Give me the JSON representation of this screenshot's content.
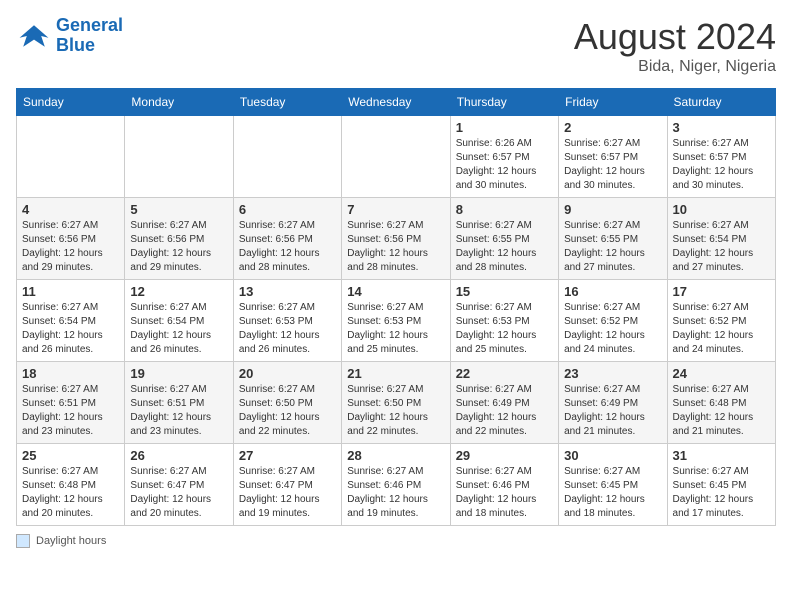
{
  "logo": {
    "line1": "General",
    "line2": "Blue"
  },
  "title": "August 2024",
  "subtitle": "Bida, Niger, Nigeria",
  "days_of_week": [
    "Sunday",
    "Monday",
    "Tuesday",
    "Wednesday",
    "Thursday",
    "Friday",
    "Saturday"
  ],
  "weeks": [
    [
      {
        "day": "",
        "info": ""
      },
      {
        "day": "",
        "info": ""
      },
      {
        "day": "",
        "info": ""
      },
      {
        "day": "",
        "info": ""
      },
      {
        "day": "1",
        "info": "Sunrise: 6:26 AM\nSunset: 6:57 PM\nDaylight: 12 hours and 30 minutes."
      },
      {
        "day": "2",
        "info": "Sunrise: 6:27 AM\nSunset: 6:57 PM\nDaylight: 12 hours and 30 minutes."
      },
      {
        "day": "3",
        "info": "Sunrise: 6:27 AM\nSunset: 6:57 PM\nDaylight: 12 hours and 30 minutes."
      }
    ],
    [
      {
        "day": "4",
        "info": "Sunrise: 6:27 AM\nSunset: 6:56 PM\nDaylight: 12 hours and 29 minutes."
      },
      {
        "day": "5",
        "info": "Sunrise: 6:27 AM\nSunset: 6:56 PM\nDaylight: 12 hours and 29 minutes."
      },
      {
        "day": "6",
        "info": "Sunrise: 6:27 AM\nSunset: 6:56 PM\nDaylight: 12 hours and 28 minutes."
      },
      {
        "day": "7",
        "info": "Sunrise: 6:27 AM\nSunset: 6:56 PM\nDaylight: 12 hours and 28 minutes."
      },
      {
        "day": "8",
        "info": "Sunrise: 6:27 AM\nSunset: 6:55 PM\nDaylight: 12 hours and 28 minutes."
      },
      {
        "day": "9",
        "info": "Sunrise: 6:27 AM\nSunset: 6:55 PM\nDaylight: 12 hours and 27 minutes."
      },
      {
        "day": "10",
        "info": "Sunrise: 6:27 AM\nSunset: 6:54 PM\nDaylight: 12 hours and 27 minutes."
      }
    ],
    [
      {
        "day": "11",
        "info": "Sunrise: 6:27 AM\nSunset: 6:54 PM\nDaylight: 12 hours and 26 minutes."
      },
      {
        "day": "12",
        "info": "Sunrise: 6:27 AM\nSunset: 6:54 PM\nDaylight: 12 hours and 26 minutes."
      },
      {
        "day": "13",
        "info": "Sunrise: 6:27 AM\nSunset: 6:53 PM\nDaylight: 12 hours and 26 minutes."
      },
      {
        "day": "14",
        "info": "Sunrise: 6:27 AM\nSunset: 6:53 PM\nDaylight: 12 hours and 25 minutes."
      },
      {
        "day": "15",
        "info": "Sunrise: 6:27 AM\nSunset: 6:53 PM\nDaylight: 12 hours and 25 minutes."
      },
      {
        "day": "16",
        "info": "Sunrise: 6:27 AM\nSunset: 6:52 PM\nDaylight: 12 hours and 24 minutes."
      },
      {
        "day": "17",
        "info": "Sunrise: 6:27 AM\nSunset: 6:52 PM\nDaylight: 12 hours and 24 minutes."
      }
    ],
    [
      {
        "day": "18",
        "info": "Sunrise: 6:27 AM\nSunset: 6:51 PM\nDaylight: 12 hours and 23 minutes."
      },
      {
        "day": "19",
        "info": "Sunrise: 6:27 AM\nSunset: 6:51 PM\nDaylight: 12 hours and 23 minutes."
      },
      {
        "day": "20",
        "info": "Sunrise: 6:27 AM\nSunset: 6:50 PM\nDaylight: 12 hours and 22 minutes."
      },
      {
        "day": "21",
        "info": "Sunrise: 6:27 AM\nSunset: 6:50 PM\nDaylight: 12 hours and 22 minutes."
      },
      {
        "day": "22",
        "info": "Sunrise: 6:27 AM\nSunset: 6:49 PM\nDaylight: 12 hours and 22 minutes."
      },
      {
        "day": "23",
        "info": "Sunrise: 6:27 AM\nSunset: 6:49 PM\nDaylight: 12 hours and 21 minutes."
      },
      {
        "day": "24",
        "info": "Sunrise: 6:27 AM\nSunset: 6:48 PM\nDaylight: 12 hours and 21 minutes."
      }
    ],
    [
      {
        "day": "25",
        "info": "Sunrise: 6:27 AM\nSunset: 6:48 PM\nDaylight: 12 hours and 20 minutes."
      },
      {
        "day": "26",
        "info": "Sunrise: 6:27 AM\nSunset: 6:47 PM\nDaylight: 12 hours and 20 minutes."
      },
      {
        "day": "27",
        "info": "Sunrise: 6:27 AM\nSunset: 6:47 PM\nDaylight: 12 hours and 19 minutes."
      },
      {
        "day": "28",
        "info": "Sunrise: 6:27 AM\nSunset: 6:46 PM\nDaylight: 12 hours and 19 minutes."
      },
      {
        "day": "29",
        "info": "Sunrise: 6:27 AM\nSunset: 6:46 PM\nDaylight: 12 hours and 18 minutes."
      },
      {
        "day": "30",
        "info": "Sunrise: 6:27 AM\nSunset: 6:45 PM\nDaylight: 12 hours and 18 minutes."
      },
      {
        "day": "31",
        "info": "Sunrise: 6:27 AM\nSunset: 6:45 PM\nDaylight: 12 hours and 17 minutes."
      }
    ]
  ],
  "footer_label": "Daylight hours"
}
